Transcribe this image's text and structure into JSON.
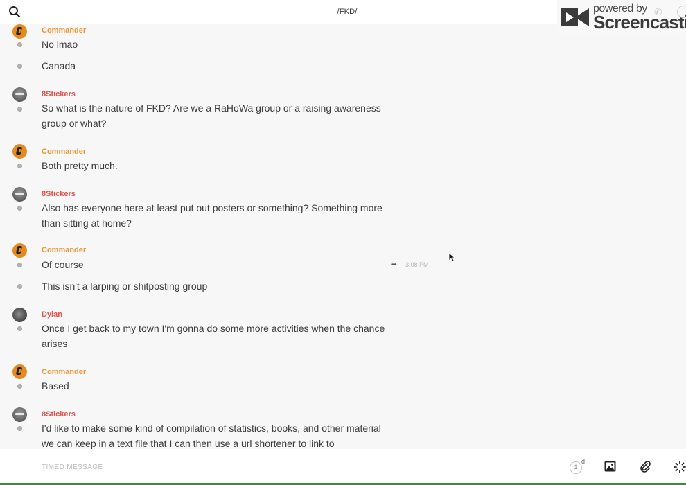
{
  "header": {
    "channel_title": "/FKD/",
    "search_icon": "search-icon"
  },
  "watermark": {
    "line1": "powered by",
    "line2": "Screencastify"
  },
  "messages": [
    {
      "name": "Commander",
      "text": "No lmao"
    },
    {
      "text": "Canada"
    },
    {
      "name": "8Stickers",
      "text": "So what is the nature of FKD? Are we a RaHoWa group or a raising awareness group or what?"
    },
    {
      "name": "Commander",
      "text": "Both pretty much."
    },
    {
      "name": "8Stickers",
      "text": "Also has everyone here at least put out posters or something? Something more than sitting at home?"
    },
    {
      "name": "Commander",
      "text": "Of course",
      "more": "•••",
      "time": "3:08 PM"
    },
    {
      "text": "This isn't a larping or shitposting group"
    },
    {
      "name": "Dylan",
      "text": "Once I get back to my town I'm gonna do some more activities when the chance arises"
    },
    {
      "name": "Commander",
      "text": "Based"
    },
    {
      "name": "8Stickers",
      "text": "I'd like to make some kind of compilation of statistics, books, and other material we can keep in a text file that I can then use a url shortener to link to"
    }
  ],
  "composer": {
    "placeholder": "TIMED MESSAGE",
    "timer_value": "1",
    "timer_unit": "d"
  },
  "colors": {
    "commander_name": "#f0952a",
    "other_name": "#e0534c",
    "background": "#f7f7f7",
    "bottom_bar": "#3a8d3a"
  }
}
